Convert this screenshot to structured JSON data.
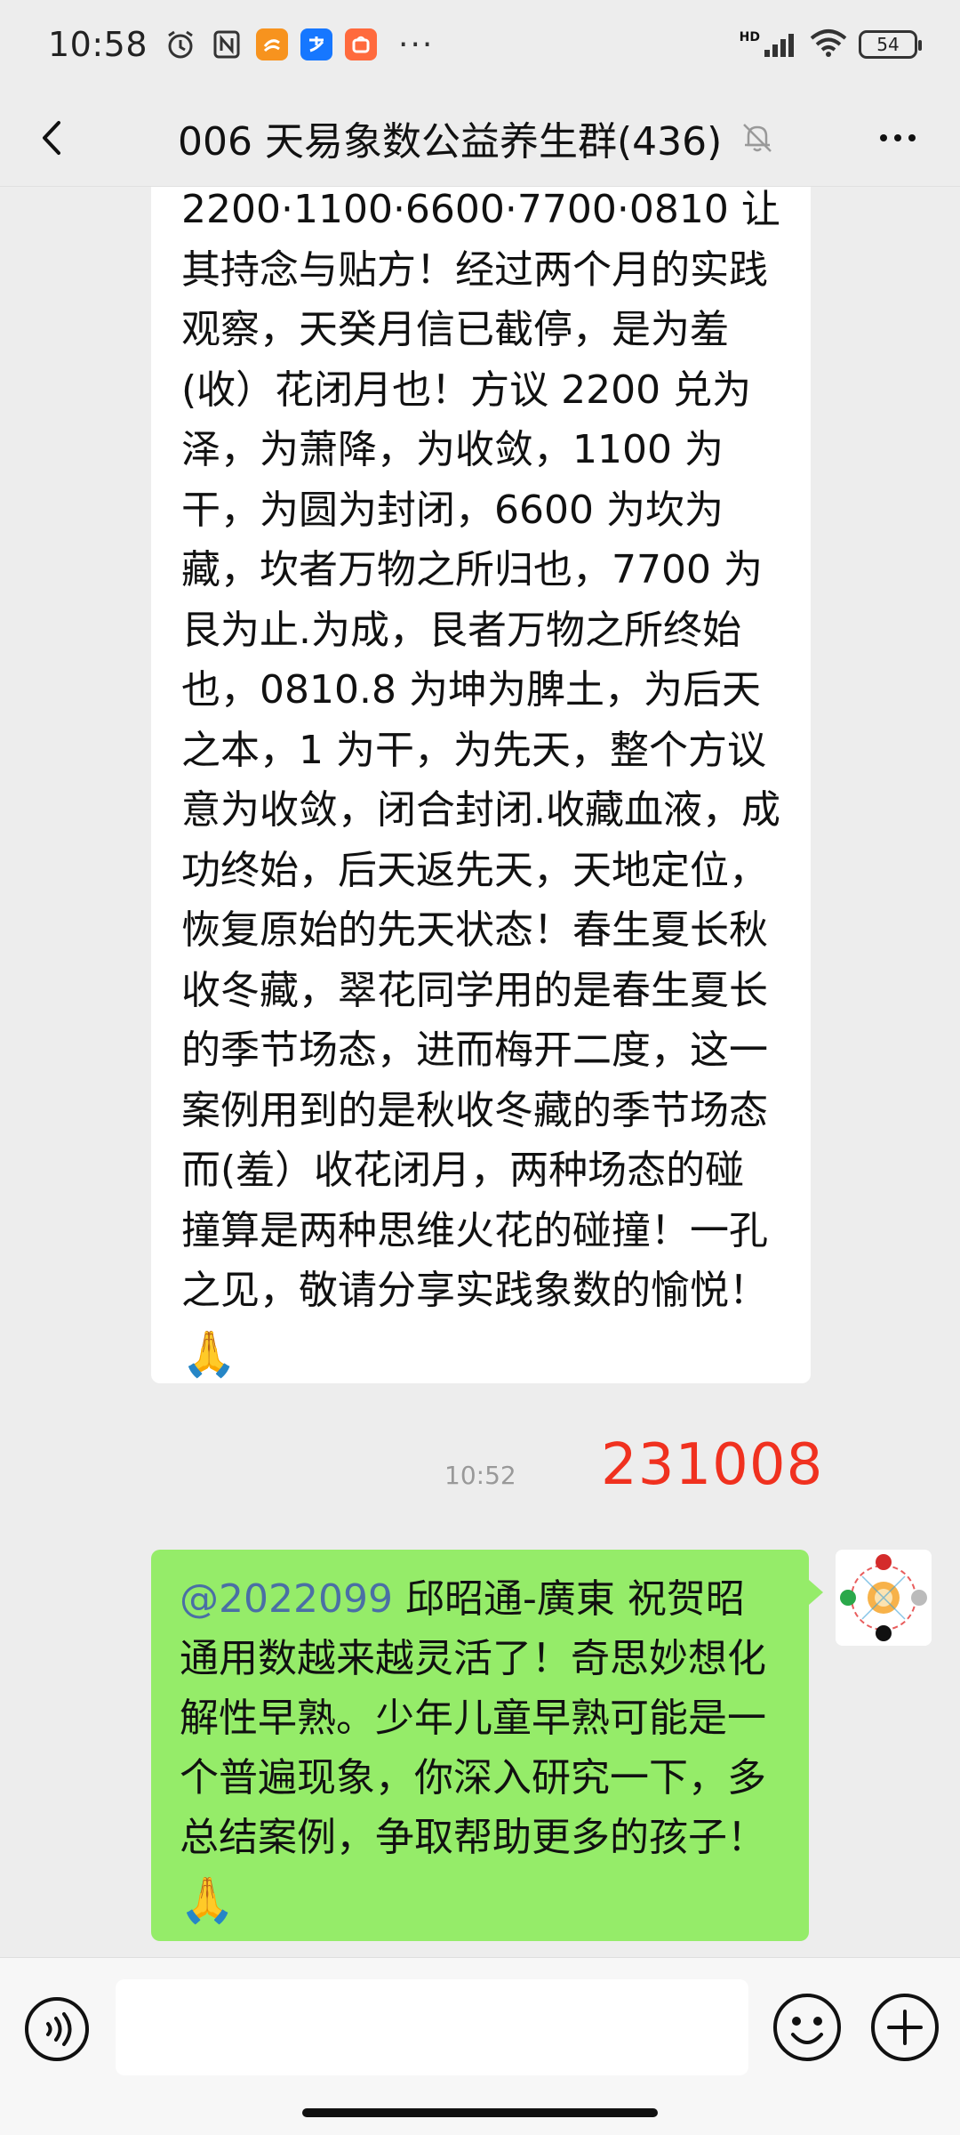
{
  "status_bar": {
    "time": "10:58",
    "more": "···",
    "network": "HD",
    "battery": "54"
  },
  "nav": {
    "title": "006 天易象数公益养生群(436)"
  },
  "received_message": {
    "text": "2200·1100·6600·7700·0810 让其持念与贴方！经过两个月的实践观察，天癸月信已截停，是为羞(收）花闭月也！方议 2200 兑为泽，为萧降，为收敛，1100 为干，为圆为封闭，6600 为坎为藏，坎者万物之所归也，7700 为艮为止.为成，艮者万物之所终始也，0810.8 为坤为脾土，为后天之本，1 为干，为先天，整个方议意为收敛，闭合封闭.收藏血液，成功终始，后天返先天，天地定位，恢复原始的先天状态！春生夏长秋收冬藏，翠花同学用的是春生夏长的季节场态，进而梅开二度，这一案例用到的是秋收冬藏的季节场态而(羞）收花闭月，两种场态的碰撞算是两种思维火花的碰撞！一孔之见，敬请分享实践象数的愉悦！",
    "emoji": "🙏"
  },
  "timestamp": "10:52",
  "red_note": "231008",
  "sent_message": {
    "mention": "@2022099",
    "text": " 邱昭通-廣東  祝贺昭通用数越来越灵活了！奇思妙想化解性早熟。少年儿童早熟可能是一个普遍现象，你深入研究一下，多总结案例，争取帮助更多的孩子！",
    "emoji": "🙏"
  },
  "input": {
    "value": ""
  },
  "colors": {
    "sent_bubble": "#95ec69",
    "received_bubble": "#ffffff",
    "background": "#ededed",
    "red_note": "#f0311f",
    "mention": "#4a6fa5"
  }
}
